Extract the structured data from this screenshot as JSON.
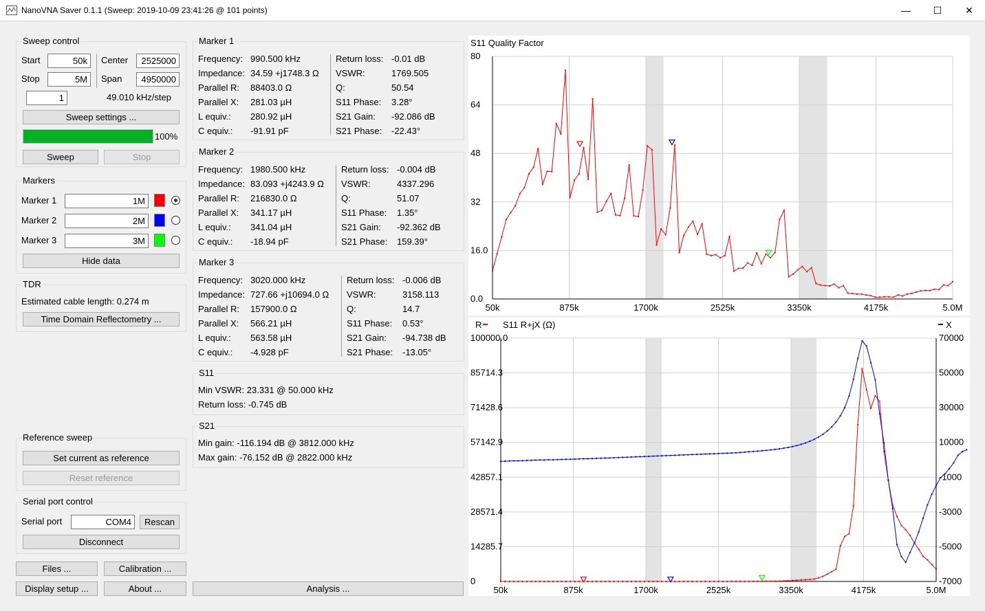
{
  "window": {
    "title": "NanoVNA Saver 0.1.1 (Sweep: 2019-10-09 23:41:26 @ 101 points)",
    "min_glyph": "—",
    "max_glyph": "☐",
    "close_glyph": "✕"
  },
  "sweep": {
    "title": "Sweep control",
    "start_label": "Start",
    "start_value": "50k",
    "stop_label": "Stop",
    "stop_value": "5M",
    "center_label": "Center",
    "center_value": "2525000",
    "span_label": "Span",
    "span_value": "4950000",
    "segments": "1",
    "step": "49.010 kHz/step",
    "settings_button": "Sweep settings ...",
    "progress": 1.0,
    "progress_text": "100%",
    "sweep_button": "Sweep",
    "stop_button": "Stop"
  },
  "markers_panel": {
    "title": "Markers",
    "items": [
      {
        "label": "Marker 1",
        "value": "1M",
        "color": "#ff0000",
        "selected": true
      },
      {
        "label": "Marker 2",
        "value": "2M",
        "color": "#0000ff",
        "selected": false
      },
      {
        "label": "Marker 3",
        "value": "3M",
        "color": "#00ff00",
        "selected": false
      }
    ],
    "hide_button": "Hide data"
  },
  "tdr": {
    "title": "TDR",
    "estimate": "Estimated cable length: 0.274 m",
    "button": "Time Domain Reflectometry ..."
  },
  "reference": {
    "title": "Reference sweep",
    "set_button": "Set current as reference",
    "reset_button": "Reset reference"
  },
  "serial": {
    "title": "Serial port control",
    "port_label": "Serial port",
    "port_value": "COM4",
    "rescan_button": "Rescan",
    "disconnect_button": "Disconnect"
  },
  "bottom_buttons": {
    "files": "Files ...",
    "calibration": "Calibration ...",
    "display": "Display setup ...",
    "about": "About ...",
    "analysis": "Analysis ..."
  },
  "marker_details": [
    {
      "title": "Marker 1",
      "left": [
        [
          "Frequency:",
          "990.500 kHz"
        ],
        [
          "Impedance:",
          "34.59 +j1748.3 Ω"
        ],
        [
          "Parallel R:",
          "88403.0 Ω"
        ],
        [
          "Parallel X:",
          "281.03 µH"
        ],
        [
          "L equiv.:",
          "280.92 µH"
        ],
        [
          "C equiv.:",
          "-91.91 pF"
        ]
      ],
      "right": [
        [
          "Return loss:",
          "-0.01 dB"
        ],
        [
          "VSWR:",
          "1769.505"
        ],
        [
          "Q:",
          "50.54"
        ],
        [
          "S11  Phase:",
          "3.28°"
        ],
        [
          "S21  Gain:",
          "-92.086 dB"
        ],
        [
          "S21  Phase:",
          "-22.43°"
        ]
      ]
    },
    {
      "title": "Marker 2",
      "left": [
        [
          "Frequency:",
          "1980.500 kHz"
        ],
        [
          "Impedance:",
          "83.093 +j4243.9 Ω"
        ],
        [
          "Parallel R:",
          "216830.0 Ω"
        ],
        [
          "Parallel X:",
          "341.17 µH"
        ],
        [
          "L equiv.:",
          "341.04 µH"
        ],
        [
          "C equiv.:",
          "-18.94 pF"
        ]
      ],
      "right": [
        [
          "Return loss:",
          "-0.004 dB"
        ],
        [
          "VSWR:",
          "4337.296"
        ],
        [
          "Q:",
          "51.07"
        ],
        [
          "S11  Phase:",
          "1.35°"
        ],
        [
          "S21  Gain:",
          "-92.362 dB"
        ],
        [
          "S21  Phase:",
          "159.39°"
        ]
      ]
    },
    {
      "title": "Marker 3",
      "left": [
        [
          "Frequency:",
          "3020.000 kHz"
        ],
        [
          "Impedance:",
          "727.66 +j10694.0 Ω"
        ],
        [
          "Parallel R:",
          "157900.0 Ω"
        ],
        [
          "Parallel X:",
          "566.21 µH"
        ],
        [
          "L equiv.:",
          "563.58 µH"
        ],
        [
          "C equiv.:",
          "-4.928 pF"
        ]
      ],
      "right": [
        [
          "Return loss:",
          "-0.006 dB"
        ],
        [
          "VSWR:",
          "3158.113"
        ],
        [
          "Q:",
          "14.7"
        ],
        [
          "S11  Phase:",
          "0.53°"
        ],
        [
          "S21  Gain:",
          "-94.738 dB"
        ],
        [
          "S21  Phase:",
          "-13.05°"
        ]
      ]
    }
  ],
  "s11_summary": {
    "title": "S11",
    "lines": [
      "Min VSWR:   23.331 @ 50.000 kHz",
      "Return loss: -0.745 dB"
    ]
  },
  "s21_summary": {
    "title": "S21",
    "lines": [
      "Min gain: -116.194 dB @ 3812.000 kHz",
      "Max gain: -76.152 dB @ 2822.000 kHz"
    ]
  },
  "chart_data": [
    {
      "type": "line",
      "title": "S11  Quality Factor",
      "x_unit": "kHz",
      "xlim": [
        50,
        5000
      ],
      "ylim": [
        0,
        80
      ],
      "grid": true,
      "x_tick_labels": [
        "50k",
        "875k",
        "1700k",
        "2525k",
        "3350k",
        "4175k",
        "5.0M"
      ],
      "y_tick_labels": [
        "80",
        "64",
        "48",
        "32",
        "16.0",
        "0.0"
      ],
      "y_tick_values": [
        80,
        64,
        48,
        32,
        16,
        0
      ],
      "shaded_bands": [
        [
          1700,
          1890
        ],
        [
          3350,
          3650
        ]
      ],
      "series": [
        {
          "color": "#ff0000",
          "values": [
            9.3,
            14.9,
            20.4,
            26.2,
            28.5,
            30.7,
            34.7,
            36.7,
            41.3,
            43.4,
            49.6,
            37.8,
            42.1,
            42,
            57.9,
            54.4,
            75.4,
            33.4,
            39.2,
            41.3,
            49.9,
            39.5,
            66,
            28.6,
            29.2,
            32.2,
            34.8,
            27.7,
            27.5,
            33.2,
            44.2,
            27.4,
            27.2,
            35.9,
            50.5,
            49.2,
            17.8,
            23.1,
            21.2,
            30,
            50.8,
            15.3,
            21,
            23.7,
            25.6,
            21.3,
            24.8,
            14.8,
            14.3,
            14.6,
            13.6,
            14.3,
            20.6,
            9.2,
            10.1,
            10.2,
            11.9,
            11.1,
            15.2,
            11.6,
            14.8,
            13.6,
            15.3,
            26.2,
            29.2,
            7.3,
            8.2,
            9.6,
            10.7,
            9,
            10.3,
            5.1,
            4.6,
            4.4,
            4.3,
            4.9,
            3.7,
            4.4,
            1.9,
            1.8,
            1.6,
            1.6,
            1.3,
            1.1,
            0.6,
            0.6,
            0.7,
            0.7,
            0.6,
            1.3,
            1,
            1.6,
            1.8,
            2.3,
            2.7,
            2.8,
            2.8,
            3.2,
            3.1,
            4.6,
            4.4,
            5.7
          ]
        },
        {
          "color": "#ff0000",
          "x": [
            990.5
          ],
          "y": [
            50.54
          ],
          "marker": "triangle"
        },
        {
          "color": "#0000ff",
          "x": [
            1980.5
          ],
          "y": [
            51.07
          ],
          "marker": "triangle"
        },
        {
          "color": "#00ff00",
          "x": [
            3020
          ],
          "y": [
            14.7
          ],
          "marker": "triangle"
        }
      ]
    },
    {
      "type": "line",
      "title": "S11 R+jX (Ω)",
      "x_unit": "kHz",
      "xlim": [
        50,
        5000
      ],
      "ylim": [
        0,
        100000
      ],
      "y2lim": [
        -70000,
        70000
      ],
      "grid": true,
      "x_tick_labels": [
        "50k",
        "875k",
        "1700k",
        "2525k",
        "3350k",
        "4175k",
        "5.0M"
      ],
      "y_tick_labels": [
        "100000.0",
        "85714.3",
        "71428.6",
        "57142.9",
        "42857.1",
        "28571.4",
        "14285.7",
        "0"
      ],
      "y2_tick_labels": [
        "70000",
        "50000",
        "30000",
        "10000",
        "-1000",
        "-3000",
        "-5000",
        "-7000"
      ],
      "legend": {
        "left": "R",
        "right": "X"
      },
      "shaded_bands": [
        [
          1700,
          1880
        ],
        [
          3350,
          3640
        ]
      ],
      "series": [
        {
          "name": "R",
          "color": "#ff0000",
          "axis": "left",
          "values": [
            0,
            0,
            0,
            0,
            0,
            0,
            0,
            0,
            0,
            0,
            0,
            0,
            0,
            0,
            0,
            0,
            0,
            0,
            0,
            0,
            0,
            0,
            0,
            0,
            0,
            0,
            0,
            0,
            0,
            0,
            0,
            0,
            0,
            0,
            0,
            0,
            0,
            0,
            0,
            0,
            0,
            0,
            0,
            0,
            0,
            0,
            0,
            0,
            0,
            0,
            10,
            10,
            10,
            20,
            20,
            30,
            30,
            40,
            50,
            60,
            80,
            100,
            100,
            100,
            150,
            200,
            300,
            400,
            500,
            600,
            700,
            800,
            1000,
            1500,
            2100,
            3000,
            4000,
            5000,
            14700,
            18500,
            19600,
            31200,
            64400,
            87400,
            78900,
            71200,
            76300,
            74100,
            53500,
            41600,
            31400,
            26700,
            23100,
            21200,
            18900,
            15900,
            13200,
            10300,
            8900,
            6900,
            5100
          ]
        },
        {
          "name": "X",
          "color": "#0000ff",
          "axis": "right",
          "values": [
            -900,
            -800,
            -700,
            -600,
            -600,
            -500,
            -400,
            -300,
            -200,
            -100,
            -100,
            0,
            0,
            100,
            200,
            300,
            300,
            400,
            500,
            600,
            600,
            700,
            800,
            900,
            1000,
            1100,
            1200,
            1300,
            1400,
            1500,
            1600,
            1700,
            1800,
            1900,
            2000,
            2100,
            2200,
            2300,
            2400,
            2500,
            2600,
            2700,
            2800,
            2900,
            3000,
            3100,
            3200,
            3300,
            3400,
            3500,
            3600,
            3700,
            3800,
            3900,
            4000,
            4200,
            4400,
            4600,
            4800,
            5000,
            5200,
            5400,
            5700,
            6000,
            6300,
            6700,
            7100,
            7600,
            8200,
            8900,
            9700,
            10700,
            11800,
            13100,
            14700,
            16600,
            18900,
            21700,
            25300,
            30000,
            36700,
            46200,
            58300,
            68400,
            65500,
            55900,
            46000,
            26600,
            9800,
            -11700,
            -28000,
            -48800,
            -55600,
            -59000,
            -53300,
            -48000,
            -41400,
            -33600,
            -26000,
            -19800,
            -14800,
            -10300,
            -8100,
            -5200,
            -1800,
            2600,
            4700,
            5800
          ]
        },
        {
          "color": "#ff0000",
          "x": [
            990.5
          ],
          "y": [
            83.093
          ],
          "axis": "left",
          "marker": "triangle"
        },
        {
          "color": "#0000ff",
          "x": [
            1980.5
          ],
          "y": [
            83.093
          ],
          "axis": "left",
          "marker": "triangle"
        },
        {
          "color": "#00ff00",
          "x": [
            3020
          ],
          "y": [
            727.66
          ],
          "axis": "left",
          "marker": "triangle"
        }
      ]
    }
  ]
}
